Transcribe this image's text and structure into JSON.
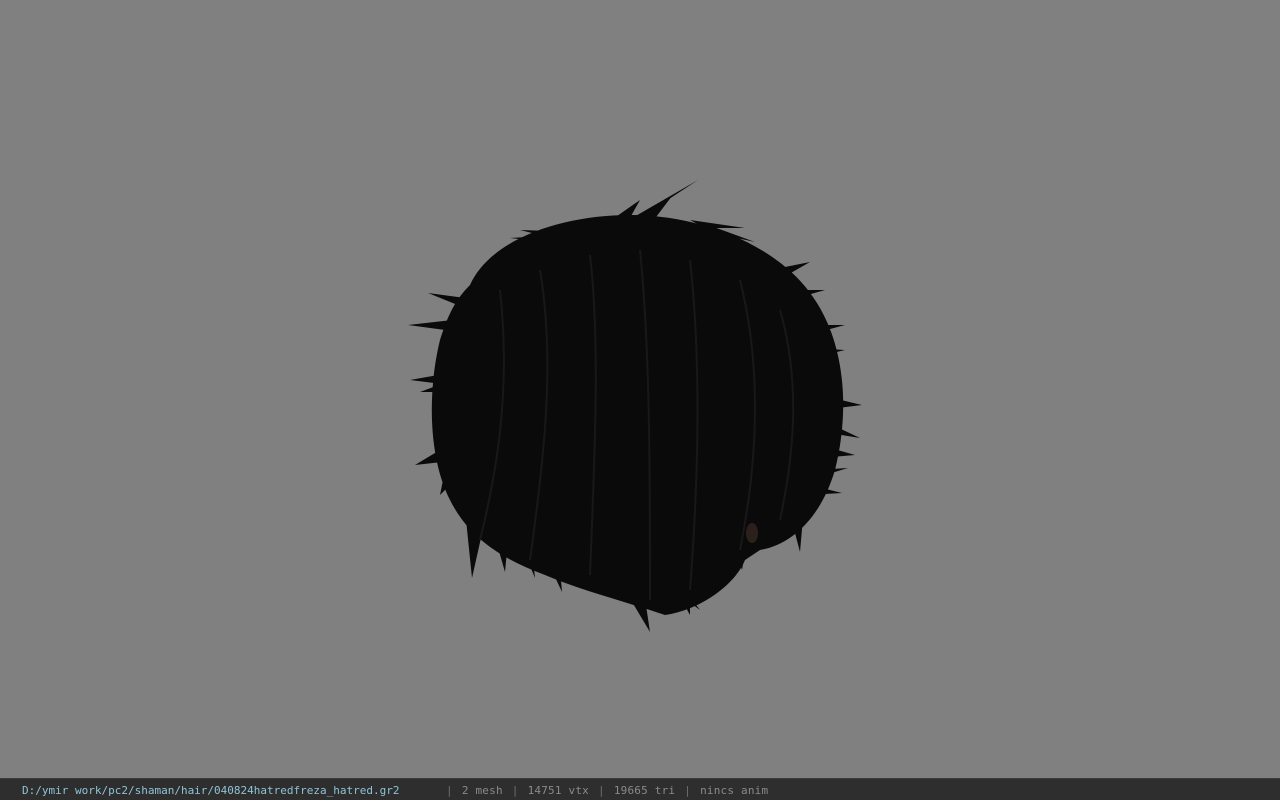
{
  "viewport": {
    "background_color": "#808080",
    "model": {
      "description_icon": "hair-mesh-icon",
      "color": "#0b0b0b"
    }
  },
  "statusbar": {
    "path": "D:/ymir work/pc2/shaman/hair/040824hatredfreza_hatred.gr2",
    "separator": "|",
    "mesh": "2 mesh",
    "vertices": "14751 vtx",
    "triangles": "19665 tri",
    "animation": "nincs anim",
    "path_color": "#8fc3d6",
    "text_color": "#8a8a8a",
    "background_color": "#2e2e2e"
  }
}
